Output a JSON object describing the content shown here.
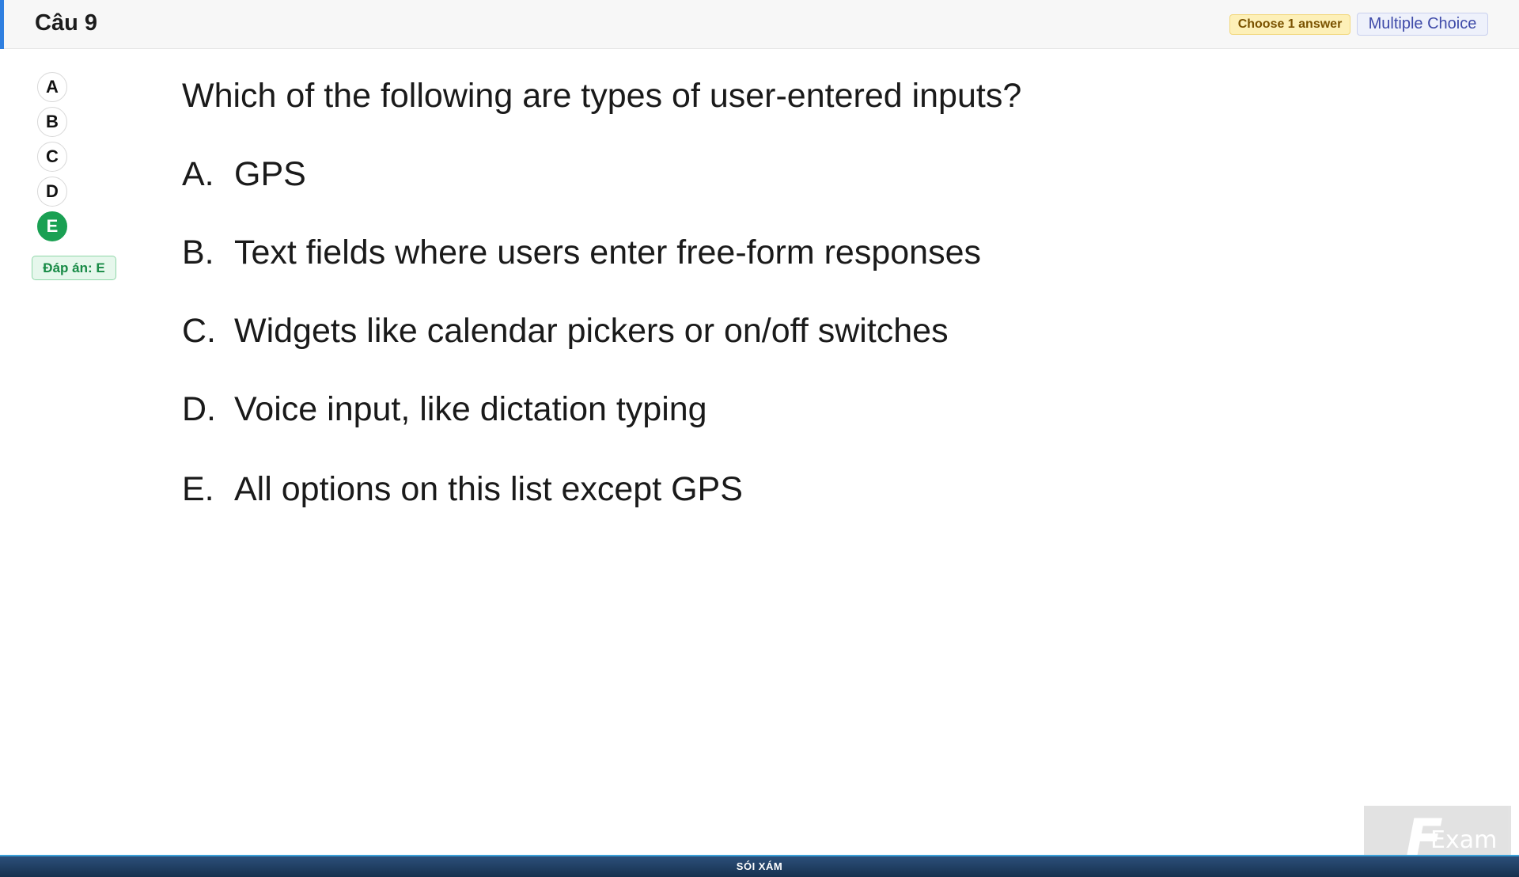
{
  "header": {
    "title": "Câu 9",
    "choose_badge": "Choose 1 answer",
    "type_badge": "Multiple Choice"
  },
  "selector": {
    "options": [
      "A",
      "B",
      "C",
      "D",
      "E"
    ],
    "selected": "E",
    "answer_badge": "Đáp án: E"
  },
  "question": {
    "text": "Which of the following are types of user-entered inputs?",
    "choices": [
      {
        "letter": "A.",
        "text": "GPS"
      },
      {
        "letter": "B.",
        "text": "Text fields where users enter free-form responses"
      },
      {
        "letter": "C.",
        "text": "Widgets like calendar pickers or on/off switches"
      },
      {
        "letter": "D.",
        "text": "Voice input, like dictation typing"
      },
      {
        "letter": "E.",
        "text": "All options on this list except GPS"
      }
    ]
  },
  "footer": {
    "text": "SÓI XÁM"
  },
  "logo": {
    "letter": "F",
    "text": "Exam"
  },
  "colors": {
    "accent": "#2f7fe0",
    "selected": "#1aa053",
    "answer_badge_bg": "#e6f7ec",
    "choose_badge_bg": "#fdf0b8",
    "type_badge_bg": "#eef1fb",
    "footer_bg": "#1f3d5f"
  }
}
